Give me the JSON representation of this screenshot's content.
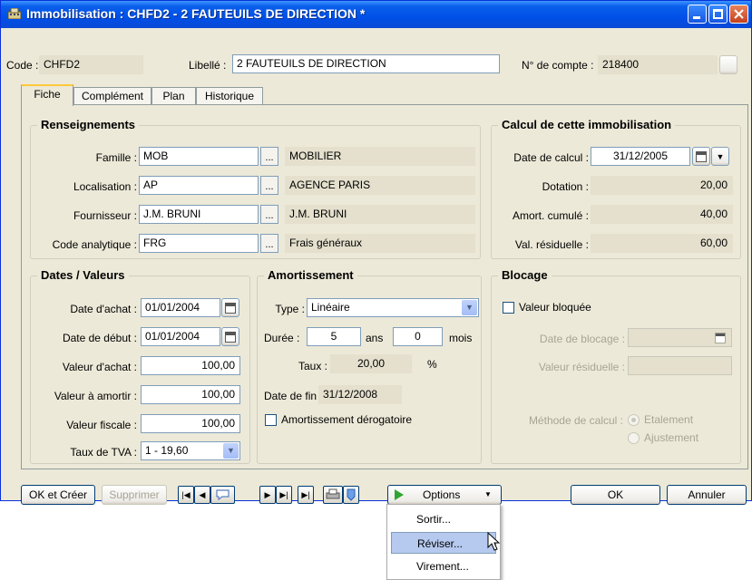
{
  "window": {
    "title": "Immobilisation : CHFD2 - 2 FAUTEUILS DE DIRECTION *",
    "title_icon": "building-icon",
    "controls": [
      "minimize-icon",
      "maximize-icon",
      "close-icon"
    ]
  },
  "header": {
    "code_label": "Code :",
    "code_value": "CHFD2",
    "libelle_label": "Libellé :",
    "libelle_value": "2 FAUTEUILS DE DIRECTION",
    "compte_label": "N° de compte :",
    "compte_value": "218400"
  },
  "tabs": [
    {
      "label": "Fiche",
      "active": true
    },
    {
      "label": "Complément",
      "active": false
    },
    {
      "label": "Plan",
      "active": false
    },
    {
      "label": "Historique",
      "active": false
    }
  ],
  "renseignements": {
    "title": "Renseignements",
    "rows": [
      {
        "label": "Famille :",
        "code": "MOB",
        "desc": "MOBILIER"
      },
      {
        "label": "Localisation :",
        "code": "AP",
        "desc": "AGENCE PARIS"
      },
      {
        "label": "Fournisseur :",
        "code": "J.M. BRUNI",
        "desc": "J.M. BRUNI"
      },
      {
        "label": "Code analytique :",
        "code": "FRG",
        "desc": "Frais généraux"
      }
    ],
    "lookup_button": "..."
  },
  "calcul": {
    "title": "Calcul de cette immobilisation",
    "date_label": "Date de calcul :",
    "date_value": "31/12/2005",
    "dotation_label": "Dotation :",
    "dotation_value": "20,00",
    "amort_label": "Amort. cumulé :",
    "amort_value": "40,00",
    "val_label": "Val. résiduelle :",
    "val_value": "60,00"
  },
  "dates": {
    "title": "Dates / Valeurs",
    "achat_label": "Date d'achat :",
    "achat_value": "01/01/2004",
    "debut_label": "Date de début :",
    "debut_value": "01/01/2004",
    "val_achat_label": "Valeur d'achat :",
    "val_achat_value": "100,00",
    "val_amortir_label": "Valeur à amortir :",
    "val_amortir_value": "100,00",
    "val_fiscale_label": "Valeur fiscale :",
    "val_fiscale_value": "100,00",
    "tva_label": "Taux de TVA :",
    "tva_value": "1 - 19,60"
  },
  "amortissement": {
    "title": "Amortissement",
    "type_label": "Type :",
    "type_value": "Linéaire",
    "duree_label": "Durée :",
    "duree_ans": "5",
    "ans_label": "ans",
    "duree_mois": "0",
    "mois_label": "mois",
    "taux_label": "Taux :",
    "taux_value": "20,00",
    "taux_unit": "%",
    "fin_label": "Date de fin :",
    "fin_value": "31/12/2008",
    "derog_label": "Amortissement dérogatoire"
  },
  "blocage": {
    "title": "Blocage",
    "bloquee_label": "Valeur bloquée",
    "date_label": "Date de blocage :",
    "residuelle_label": "Valeur résiduelle :",
    "methode_label": "Méthode de calcul :",
    "etalement_label": "Etalement",
    "ajustement_label": "Ajustement"
  },
  "toolbar": {
    "ok_creer": "OK et Créer",
    "supprimer": "Supprimer",
    "options": "Options",
    "ok": "OK",
    "annuler": "Annuler"
  },
  "options_menu": [
    {
      "label": "Sortir...",
      "highlighted": false
    },
    {
      "label": "Réviser...",
      "highlighted": true
    },
    {
      "label": "Virement...",
      "highlighted": false
    }
  ]
}
